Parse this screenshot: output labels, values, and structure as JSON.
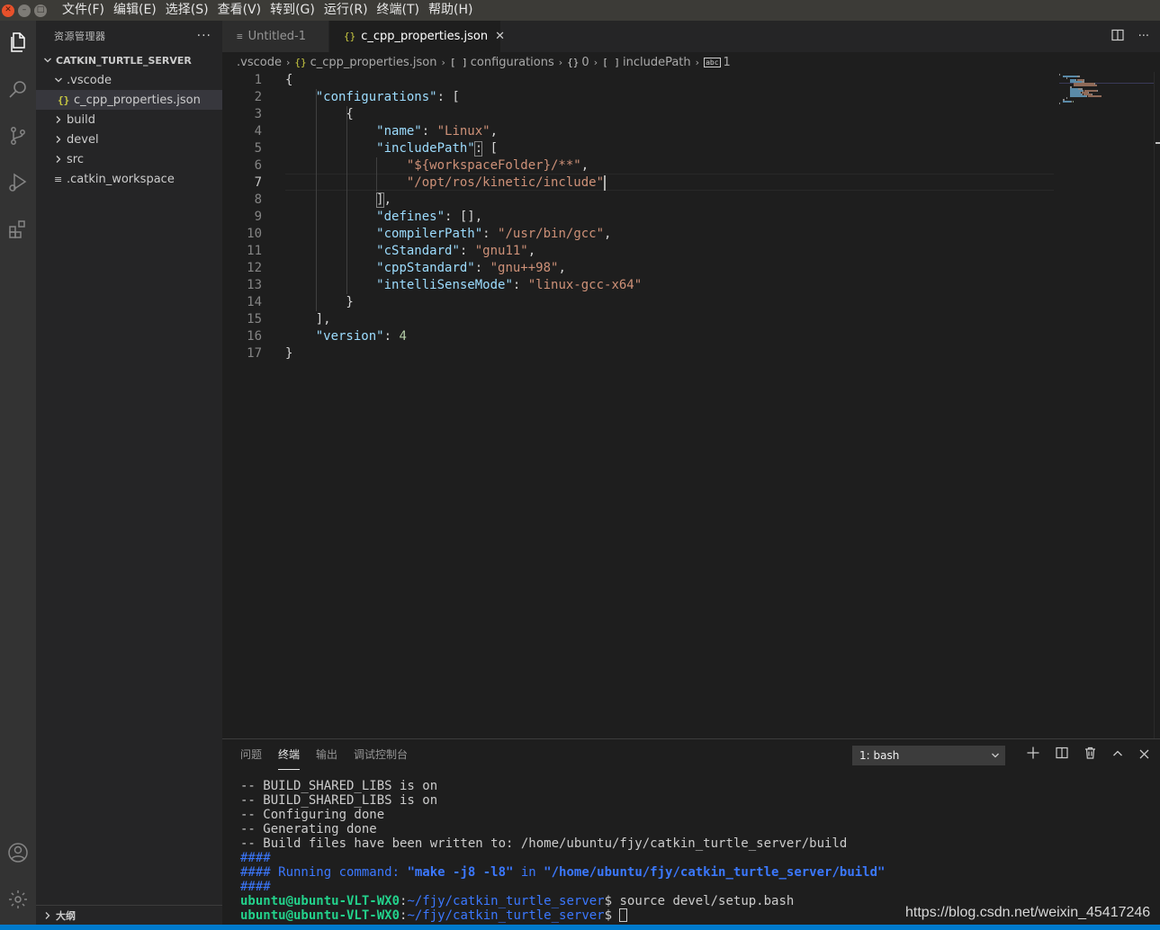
{
  "window": {
    "menu": [
      "文件(F)",
      "编辑(E)",
      "选择(S)",
      "查看(V)",
      "转到(G)",
      "运行(R)",
      "终端(T)",
      "帮助(H)"
    ]
  },
  "activity_bar": {
    "icons": [
      "files-icon",
      "search-icon",
      "source-control-icon",
      "run-debug-icon",
      "extensions-icon",
      "account-icon",
      "settings-gear-icon"
    ]
  },
  "sidebar": {
    "title": "资源管理器",
    "more": "···",
    "workspace": "CATKIN_TURTLE_SERVER",
    "tree": [
      {
        "label": ".vscode",
        "type": "folder",
        "expanded": true
      },
      {
        "label": "c_cpp_properties.json",
        "type": "json",
        "selected": true
      },
      {
        "label": "build",
        "type": "folder",
        "expanded": false
      },
      {
        "label": "devel",
        "type": "folder",
        "expanded": false
      },
      {
        "label": "src",
        "type": "folder",
        "expanded": false
      },
      {
        "label": ".catkin_workspace",
        "type": "file"
      }
    ],
    "outline": "大纲"
  },
  "editor": {
    "tabs": [
      {
        "label": "Untitled-1",
        "active": false
      },
      {
        "label": "c_cpp_properties.json",
        "active": true
      }
    ],
    "breadcrumbs": [
      ".vscode",
      "c_cpp_properties.json",
      "configurations",
      "0",
      "includePath",
      "1"
    ],
    "lines": [
      [
        {
          "t": "{",
          "c": "p"
        }
      ],
      [
        {
          "t": "    "
        },
        {
          "t": "\"configurations\"",
          "c": "k"
        },
        {
          "t": ": [",
          "c": "p"
        }
      ],
      [
        {
          "t": "        {",
          "c": "p"
        }
      ],
      [
        {
          "t": "            "
        },
        {
          "t": "\"name\"",
          "c": "k"
        },
        {
          "t": ": ",
          "c": "p"
        },
        {
          "t": "\"Linux\"",
          "c": "s"
        },
        {
          "t": ",",
          "c": "p"
        }
      ],
      [
        {
          "t": "            "
        },
        {
          "t": "\"includePath\"",
          "c": "k"
        },
        {
          "t": ": [",
          "c": "p"
        }
      ],
      [
        {
          "t": "                "
        },
        {
          "t": "\"${workspaceFolder}/**\"",
          "c": "s"
        },
        {
          "t": ",",
          "c": "p"
        }
      ],
      [
        {
          "t": "                "
        },
        {
          "t": "\"/opt/ros/kinetic/include\"",
          "c": "s"
        }
      ],
      [
        {
          "t": "            ],",
          "c": "p"
        }
      ],
      [
        {
          "t": "            "
        },
        {
          "t": "\"defines\"",
          "c": "k"
        },
        {
          "t": ": [],",
          "c": "p"
        }
      ],
      [
        {
          "t": "            "
        },
        {
          "t": "\"compilerPath\"",
          "c": "k"
        },
        {
          "t": ": ",
          "c": "p"
        },
        {
          "t": "\"/usr/bin/gcc\"",
          "c": "s"
        },
        {
          "t": ",",
          "c": "p"
        }
      ],
      [
        {
          "t": "            "
        },
        {
          "t": "\"cStandard\"",
          "c": "k"
        },
        {
          "t": ": ",
          "c": "p"
        },
        {
          "t": "\"gnu11\"",
          "c": "s"
        },
        {
          "t": ",",
          "c": "p"
        }
      ],
      [
        {
          "t": "            "
        },
        {
          "t": "\"cppStandard\"",
          "c": "k"
        },
        {
          "t": ": ",
          "c": "p"
        },
        {
          "t": "\"gnu++98\"",
          "c": "s"
        },
        {
          "t": ",",
          "c": "p"
        }
      ],
      [
        {
          "t": "            "
        },
        {
          "t": "\"intelliSenseMode\"",
          "c": "k"
        },
        {
          "t": ": ",
          "c": "p"
        },
        {
          "t": "\"linux-gcc-x64\"",
          "c": "s"
        }
      ],
      [
        {
          "t": "        }",
          "c": "p"
        }
      ],
      [
        {
          "t": "    ],",
          "c": "p"
        }
      ],
      [
        {
          "t": "    "
        },
        {
          "t": "\"version\"",
          "c": "k"
        },
        {
          "t": ": ",
          "c": "p"
        },
        {
          "t": "4",
          "c": "n"
        }
      ],
      [
        {
          "t": "}",
          "c": "p"
        }
      ]
    ],
    "current_line": 7
  },
  "panel": {
    "tabs": [
      "问题",
      "终端",
      "输出",
      "调试控制台"
    ],
    "active_tab": "终端",
    "terminal_select": "1: bash",
    "terminal_lines": [
      [
        {
          "t": "-- BUILD_SHARED_LIBS is on"
        }
      ],
      [
        {
          "t": "-- BUILD_SHARED_LIBS is on"
        }
      ],
      [
        {
          "t": "-- Configuring done"
        }
      ],
      [
        {
          "t": "-- Generating done"
        }
      ],
      [
        {
          "t": "-- Build files have been written to: /home/ubuntu/fjy/catkin_turtle_server/build"
        }
      ],
      [
        {
          "t": "####",
          "c": "t-blue"
        }
      ],
      [
        {
          "t": "#### Running command: ",
          "c": "t-blue"
        },
        {
          "t": "\"make -j8 -l8\"",
          "c": "t-boldblue"
        },
        {
          "t": " in ",
          "c": "t-blue"
        },
        {
          "t": "\"/home/ubuntu/fjy/catkin_turtle_server/build\"",
          "c": "t-boldblue"
        }
      ],
      [
        {
          "t": "####",
          "c": "t-blue"
        }
      ],
      [
        {
          "t": "ubuntu@ubuntu-VLT-WX0",
          "c": "t-green"
        },
        {
          "t": ":"
        },
        {
          "t": "~/fjy/catkin_turtle_server",
          "c": "t-path"
        },
        {
          "t": "$ source devel/setup.bash"
        }
      ],
      [
        {
          "t": "ubuntu@ubuntu-VLT-WX0",
          "c": "t-green"
        },
        {
          "t": ":"
        },
        {
          "t": "~/fjy/catkin_turtle_server",
          "c": "t-path"
        },
        {
          "t": "$ "
        }
      ]
    ]
  },
  "watermark": "https://blog.csdn.net/weixin_45417246",
  "colors": {
    "status_bar": "#007acc",
    "json_key": "#9cdcfe",
    "json_string": "#ce9178",
    "json_number": "#b5cea8"
  }
}
